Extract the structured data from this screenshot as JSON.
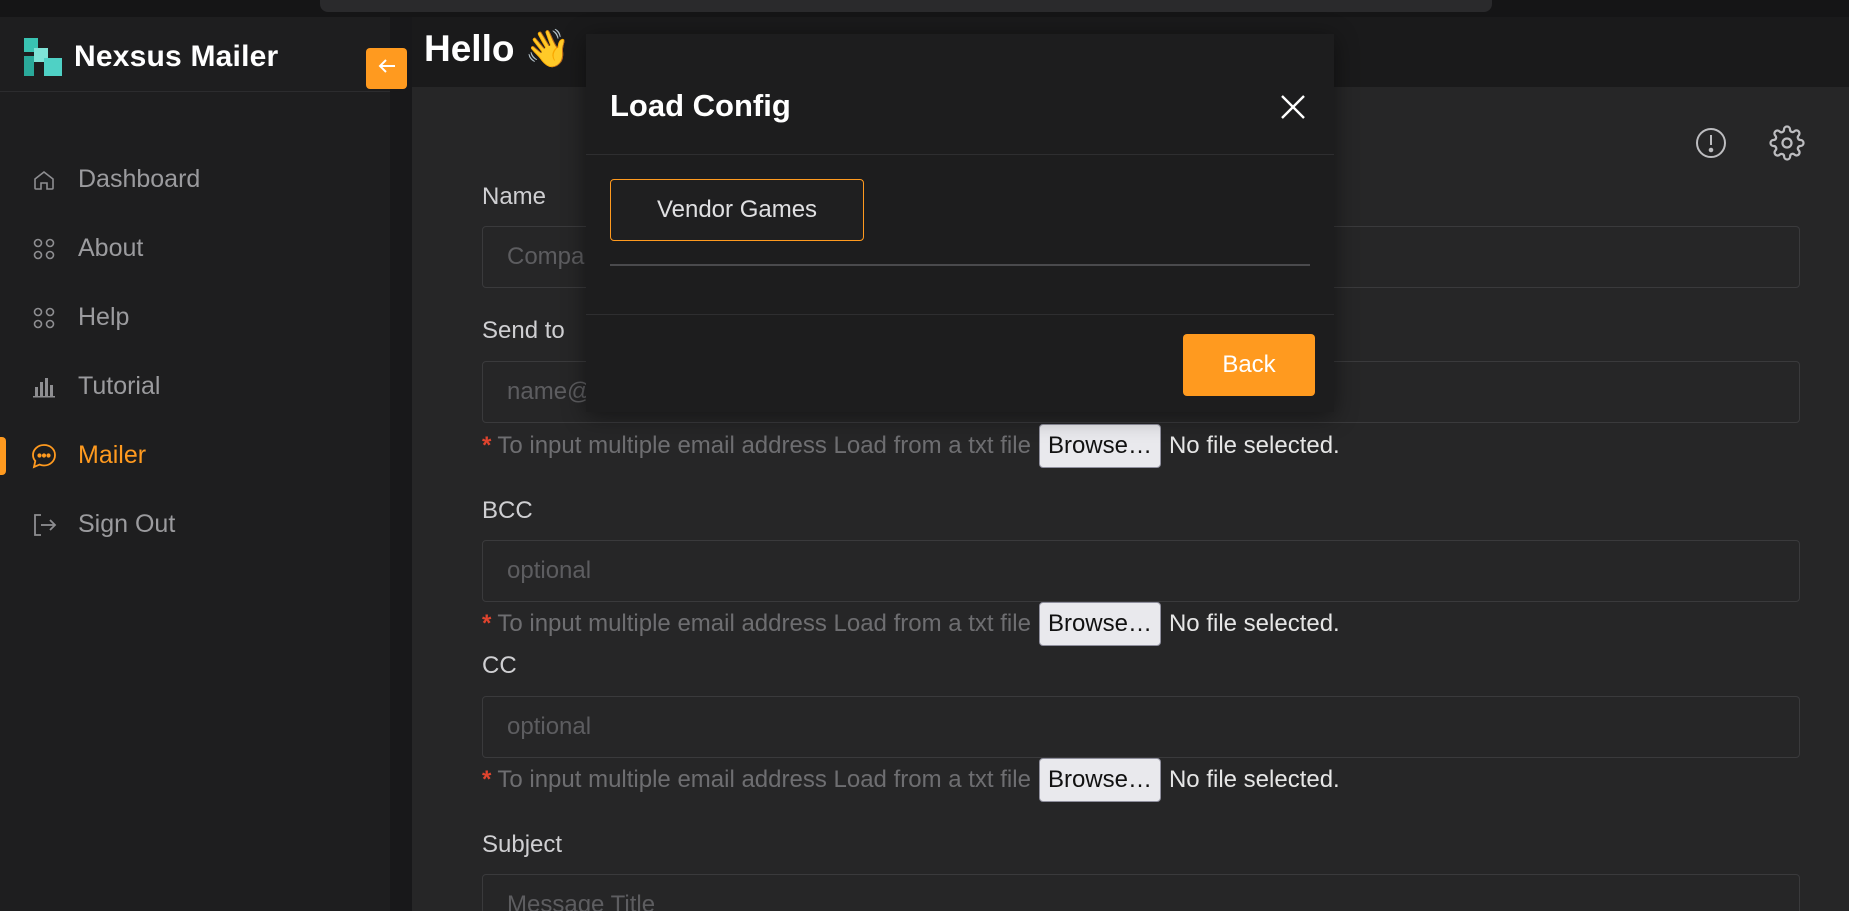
{
  "app": {
    "title": "Nexsus Mailer",
    "greeting": "Hello 👋",
    "accent_color": "#ff9a1f"
  },
  "sidebar": {
    "items": [
      {
        "label": "Dashboard",
        "icon": "home-icon",
        "active": false
      },
      {
        "label": "About",
        "icon": "grid-icon",
        "active": false
      },
      {
        "label": "Help",
        "icon": "grid-icon",
        "active": false
      },
      {
        "label": "Tutorial",
        "icon": "bar-chart-icon",
        "active": false
      },
      {
        "label": "Mailer",
        "icon": "chat-bubble-icon",
        "active": true
      },
      {
        "label": "Sign Out",
        "icon": "sign-out-icon",
        "active": false
      }
    ]
  },
  "header_icons": [
    "info-icon",
    "gear-icon"
  ],
  "form": {
    "name": {
      "label": "Name",
      "placeholder": "Compa"
    },
    "send_to": {
      "label": "Send to",
      "placeholder": "name@"
    },
    "bcc": {
      "label": "BCC",
      "placeholder": "optional"
    },
    "cc": {
      "label": "CC",
      "placeholder": "optional"
    },
    "subject": {
      "label": "Subject",
      "placeholder": "Message Title"
    },
    "file_hint": {
      "star": "*",
      "text": "To input multiple email address Load from a txt file",
      "browse": "Browse…",
      "no_file": "No file selected."
    }
  },
  "modal": {
    "title": "Load Config",
    "configs": [
      "Vendor Games"
    ],
    "back_label": "Back"
  }
}
